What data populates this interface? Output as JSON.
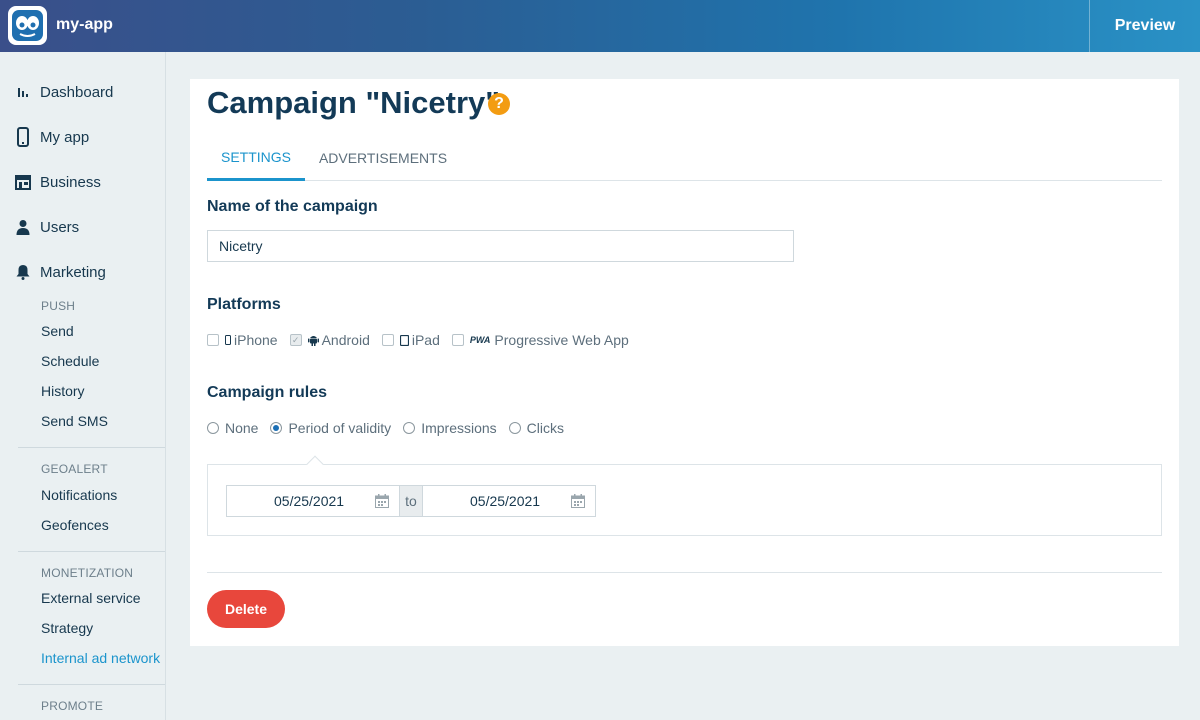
{
  "app": {
    "name": "my-app",
    "preview_label": "Preview"
  },
  "sidebar": {
    "items": [
      {
        "label": "Dashboard",
        "icon": "bar-chart-icon"
      },
      {
        "label": "My app",
        "icon": "phone-icon"
      },
      {
        "label": "Business",
        "icon": "store-icon"
      },
      {
        "label": "Users",
        "icon": "user-icon"
      },
      {
        "label": "Marketing",
        "icon": "bell-icon"
      }
    ],
    "sections": [
      {
        "heading": "PUSH",
        "items": [
          "Send",
          "Schedule",
          "History",
          "Send SMS"
        ]
      },
      {
        "heading": "GEOALERT",
        "items": [
          "Notifications",
          "Geofences"
        ]
      },
      {
        "heading": "MONETIZATION",
        "items": [
          "External service",
          "Strategy",
          "Internal ad network"
        ]
      },
      {
        "heading": "PROMOTE",
        "items": []
      }
    ],
    "active_item": "Internal ad network"
  },
  "page": {
    "title": "Campaign \"Nicetry\"",
    "help_icon": "?",
    "tabs": [
      {
        "label": "SETTINGS",
        "active": true
      },
      {
        "label": "ADVERTISEMENTS",
        "active": false
      }
    ]
  },
  "form": {
    "name_label": "Name of the campaign",
    "name_value": "Nicetry",
    "platforms_label": "Platforms",
    "platforms": [
      {
        "label": "iPhone",
        "checked": false,
        "icon": "iphone-icon"
      },
      {
        "label": "Android",
        "checked": true,
        "icon": "android-icon"
      },
      {
        "label": "iPad",
        "checked": false,
        "icon": "ipad-icon"
      },
      {
        "label": "Progressive Web App",
        "checked": false,
        "icon": "pwa-icon",
        "icon_text": "PWA"
      }
    ],
    "rules_label": "Campaign rules",
    "rules": [
      {
        "label": "None",
        "selected": false
      },
      {
        "label": "Period of validity",
        "selected": true
      },
      {
        "label": "Impressions",
        "selected": false
      },
      {
        "label": "Clicks",
        "selected": false
      }
    ],
    "period": {
      "from": "05/25/2021",
      "to_label": "to",
      "to": "05/25/2021"
    },
    "delete_label": "Delete"
  },
  "colors": {
    "accent": "#1b94cc",
    "danger": "#e8473c",
    "help": "#f39c12",
    "title": "#133a57"
  }
}
